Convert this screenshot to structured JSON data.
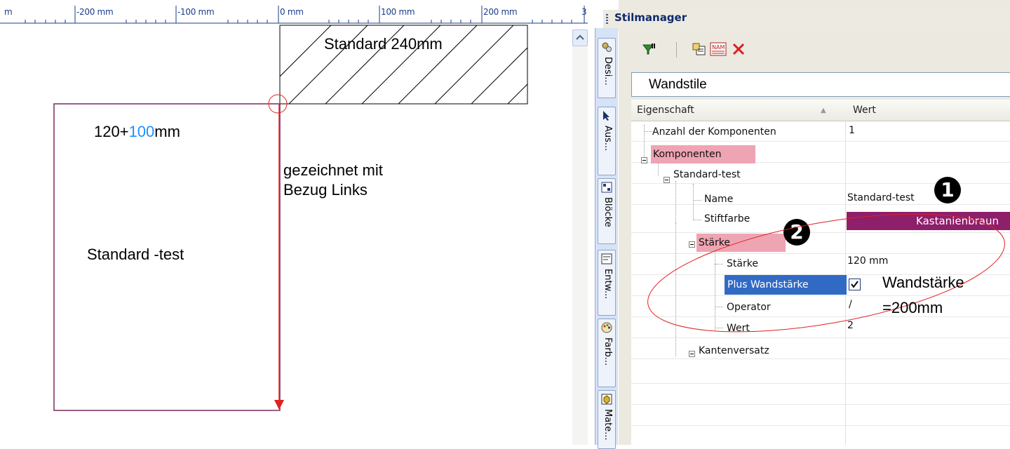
{
  "ruler": {
    "labels": [
      "m",
      "-200 mm",
      "-100 mm",
      "0 mm",
      "100 mm",
      "200 mm",
      "3"
    ]
  },
  "drawing": {
    "top_wall_label": "Standard 240mm",
    "wall_spec": {
      "base": "120+",
      "extra": "100",
      "unit": "mm"
    },
    "note_line1": "gezeichnet mit",
    "note_line2": "Bezug Links",
    "style_label": "Standard -test",
    "colors": {
      "wall_outline": "#7a2b5e",
      "arrow": "#e02020",
      "accent_number": "#1e90ff"
    }
  },
  "tabs": [
    {
      "label": "Desi...",
      "icon": "gears-icon"
    },
    {
      "label": "Aus...",
      "icon": "cursor-icon"
    },
    {
      "label": "Blöcke",
      "icon": "blocks-icon"
    },
    {
      "label": "Entw...",
      "icon": "drafts-icon"
    },
    {
      "label": "Farb...",
      "icon": "palette-icon"
    },
    {
      "label": "Mate...",
      "icon": "material-icon"
    }
  ],
  "panel": {
    "title": "Stilmanager",
    "toolbar": [
      "filter-icon",
      "new-style-icon",
      "rename-style-icon",
      "delete-icon"
    ],
    "dropdown_value": "Wandstile",
    "columns": {
      "property": "Eigenschaft",
      "value": "Wert"
    },
    "rows": {
      "anzahl": {
        "label": "Anzahl der Komponenten",
        "value": "1"
      },
      "komponenten": {
        "label": "Komponenten"
      },
      "standard_test": {
        "label": "Standard-test"
      },
      "name": {
        "label": "Name",
        "value": "Standard-test"
      },
      "stiftfarbe": {
        "label": "Stiftfarbe",
        "value": "Kastanienbraun",
        "color": "#8e1f6b"
      },
      "staerke_group": {
        "label": "Stärke"
      },
      "staerke": {
        "label": "Stärke",
        "value": "120 mm"
      },
      "plus_wand": {
        "label": "Plus Wandstärke",
        "checked": true
      },
      "operator": {
        "label": "Operator",
        "value": "/"
      },
      "wert": {
        "label": "Wert",
        "value": "2"
      },
      "kantenversatz": {
        "label": "Kantenversatz"
      }
    }
  },
  "annotations": {
    "badge1": "1",
    "badge2": "2",
    "callout_line1": "Wandstärke",
    "callout_line2": "=200mm"
  }
}
